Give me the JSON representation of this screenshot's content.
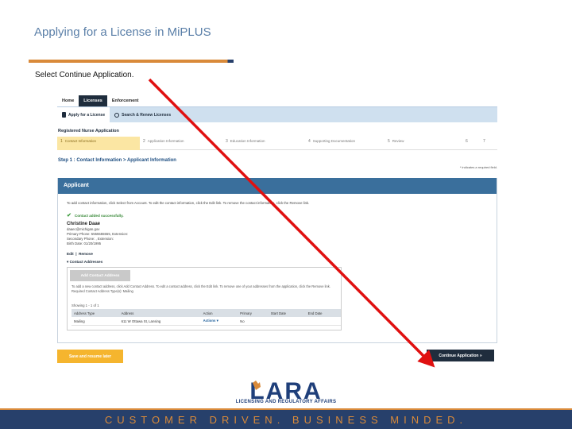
{
  "slide": {
    "title": "Applying for a License in MiPLUS",
    "instruction": "Select Continue Application.",
    "footer_text": "CUSTOMER DRIVEN. BUSINESS MINDED.",
    "logo_text": "LARA",
    "logo_subtitle": "LICENSING AND REGULATORY AFFAIRS"
  },
  "screenshot": {
    "nav_tabs": [
      "Home",
      "Licenses",
      "Enforcement"
    ],
    "active_tab": "Licenses",
    "sub_nav": [
      "Apply for a License",
      "Search & Renew Licenses"
    ],
    "application_title": "Registered Nurse Application",
    "steps": [
      {
        "num": "1",
        "label": "Contact Information"
      },
      {
        "num": "2",
        "label": "Application Information"
      },
      {
        "num": "3",
        "label": "Education Information"
      },
      {
        "num": "4",
        "label": "Supporting Documentation"
      },
      {
        "num": "5",
        "label": "Review"
      },
      {
        "num": "6",
        "label": ""
      },
      {
        "num": "7",
        "label": ""
      }
    ],
    "step_heading": "Step 1 : Contact Information > Applicant Information",
    "required_note": "* indicates a required field.",
    "panel_title": "Applicant",
    "panel_hint": "To add contact information, click Select from Account. To edit the contact information, click the Edit link. To remove the contact information, click the Remove link.",
    "success_message": "Contact added successfully.",
    "contact": {
      "name": "Christine Daae",
      "email": "daaec@michigan.gov",
      "primary_phone": "Primary Phone: 5555555555, Extension:",
      "secondary_phone": "Secondary Phone: , Extension:",
      "birth_date": "Birth Date: 01/20/1995"
    },
    "edit_label": "Edit",
    "remove_label": "Remove",
    "addresses_toggle": "Contact Addresses",
    "add_address_button": "Add Contact Address",
    "address_hint": "To add a new contact address, click Add Contact Address. To edit a contact address, click the Edit link. To remove one of your addresses from the application, click the Remove link. Required Contact Address Type(s): Mailing",
    "showing_text": "Showing 1 - 1 of 1",
    "table": {
      "headers": [
        "Address Type",
        "Address",
        "Action",
        "Primary",
        "Start Date",
        "End Date"
      ],
      "rows": [
        [
          "Mailing",
          "611 W Ottawa St, Lansing",
          "Actions",
          "No",
          "",
          ""
        ]
      ]
    },
    "save_button": "Save and resume later",
    "continue_button": "Continue Application »"
  },
  "colors": {
    "title": "#5a7fa8",
    "accent_orange": "#d98a3a",
    "navy": "#27406b",
    "arrow": "#e01010",
    "panel_header": "#3a6f9c",
    "save_button": "#f5b52e"
  }
}
